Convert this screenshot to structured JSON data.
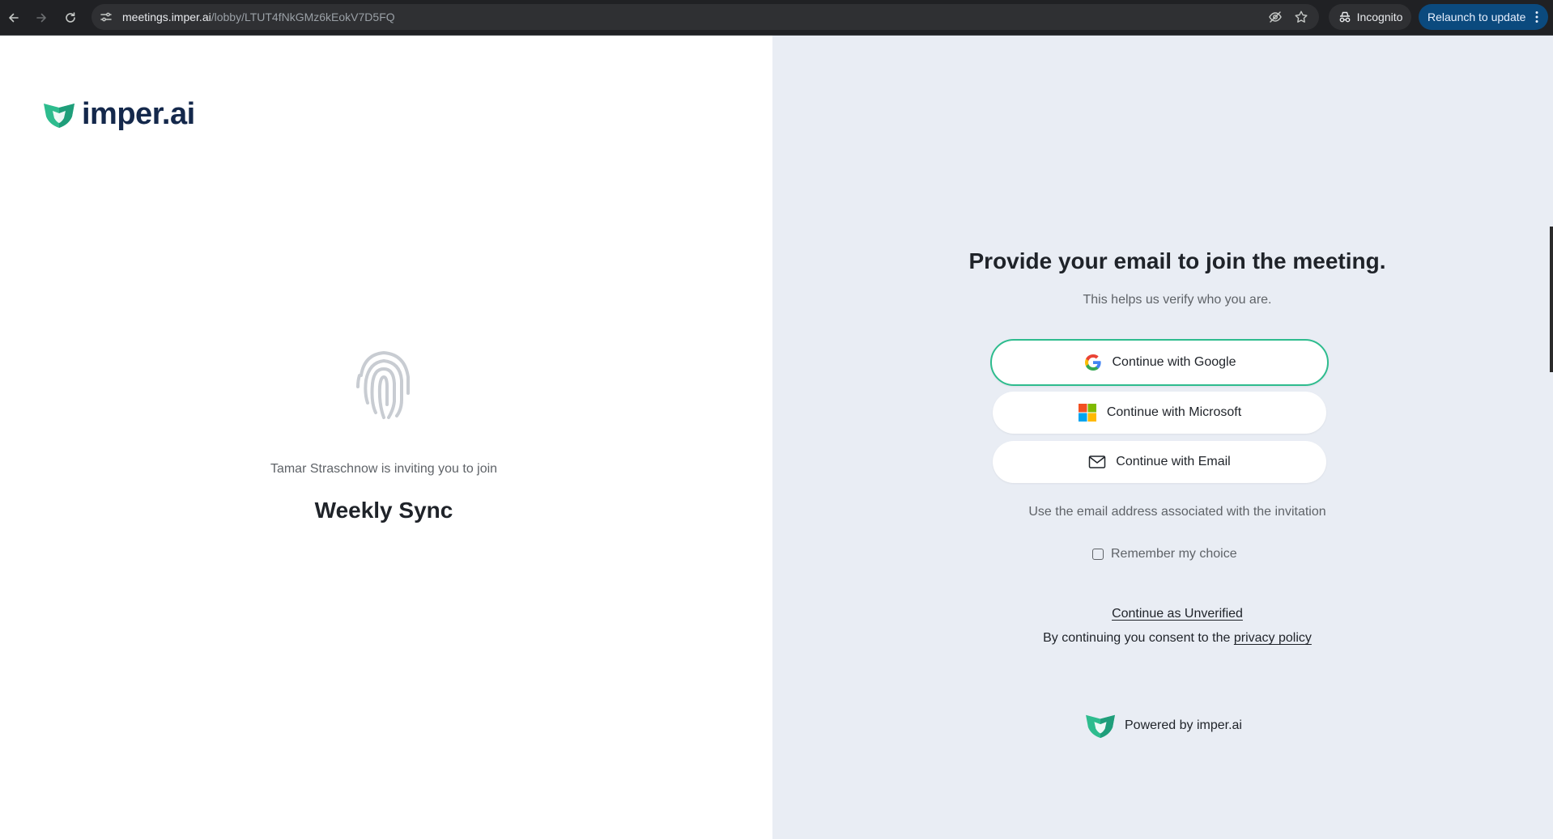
{
  "browser": {
    "url_host": "meetings.imper.ai",
    "url_path": "/lobby/LTUT4fNkGMz6kEokV7D5FQ",
    "incognito_label": "Incognito",
    "relaunch_label": "Relaunch to update"
  },
  "left_panel": {
    "logo_text": "imper.ai",
    "invite_text": "Tamar Straschnow is inviting you to join",
    "meeting_title": "Weekly Sync"
  },
  "right_panel": {
    "heading": "Provide your email to join the meeting.",
    "subheading": "This helps us verify who you are.",
    "buttons": {
      "google": "Continue with Google",
      "microsoft": "Continue with Microsoft",
      "email": "Continue with Email"
    },
    "hint": "Use the email address associated with the invitation",
    "remember_label": "Remember my choice",
    "remember_checked": false,
    "unverified_link": "Continue as Unverified",
    "consent_prefix": "By continuing you consent to the",
    "privacy_link": "privacy policy",
    "powered_by": "Powered by imper.ai"
  },
  "colors": {
    "accent_green": "#2ebc8e",
    "brand_navy": "#14284b",
    "right_bg": "#e9edf4",
    "relaunch_bg": "#0b4a7e"
  },
  "icons": {
    "back": "arrow-left-icon",
    "forward": "arrow-right-icon",
    "reload": "reload-icon",
    "site_info": "tune-icon",
    "eye_off": "eye-off-icon",
    "bookmark": "star-icon",
    "incognito": "incognito-icon",
    "menu": "kebab-menu-icon",
    "logo": "imper-shield-icon",
    "fingerprint": "fingerprint-icon",
    "google": "google-g-icon",
    "microsoft": "microsoft-logo-icon",
    "email": "envelope-icon"
  }
}
